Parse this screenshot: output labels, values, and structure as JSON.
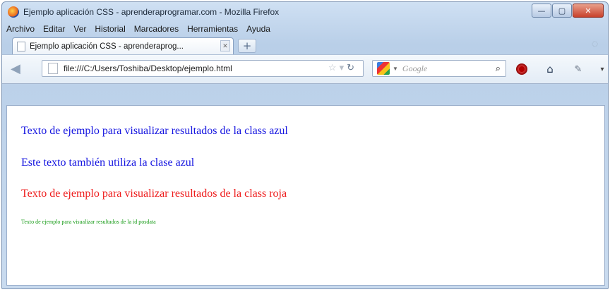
{
  "window": {
    "title": "Ejemplo aplicación CSS - aprenderaprogramar.com - Mozilla Firefox",
    "controls": {
      "minimize": "—",
      "maximize": "▢",
      "close": "✕"
    }
  },
  "menu": [
    "Archivo",
    "Editar",
    "Ver",
    "Historial",
    "Marcadores",
    "Herramientas",
    "Ayuda"
  ],
  "tab": {
    "title": "Ejemplo aplicación CSS - aprenderaprog..."
  },
  "new_tab_label": "+",
  "navigation": {
    "url": "file:///C:/Users/Toshiba/Desktop/ejemplo.html",
    "search_placeholder": "Google"
  },
  "content": {
    "line1": "Texto de ejemplo para visualizar resultados de la class azul",
    "line2": "Este texto también utiliza la clase azul",
    "line3": "Texto de ejemplo para visualizar resultados de la class roja",
    "line4": "Texto de ejemplo para visualizar resultados de la id posdata"
  },
  "colors": {
    "azul": "#1515e0",
    "roja": "#ee1c1c",
    "posdata": "#159a15"
  }
}
